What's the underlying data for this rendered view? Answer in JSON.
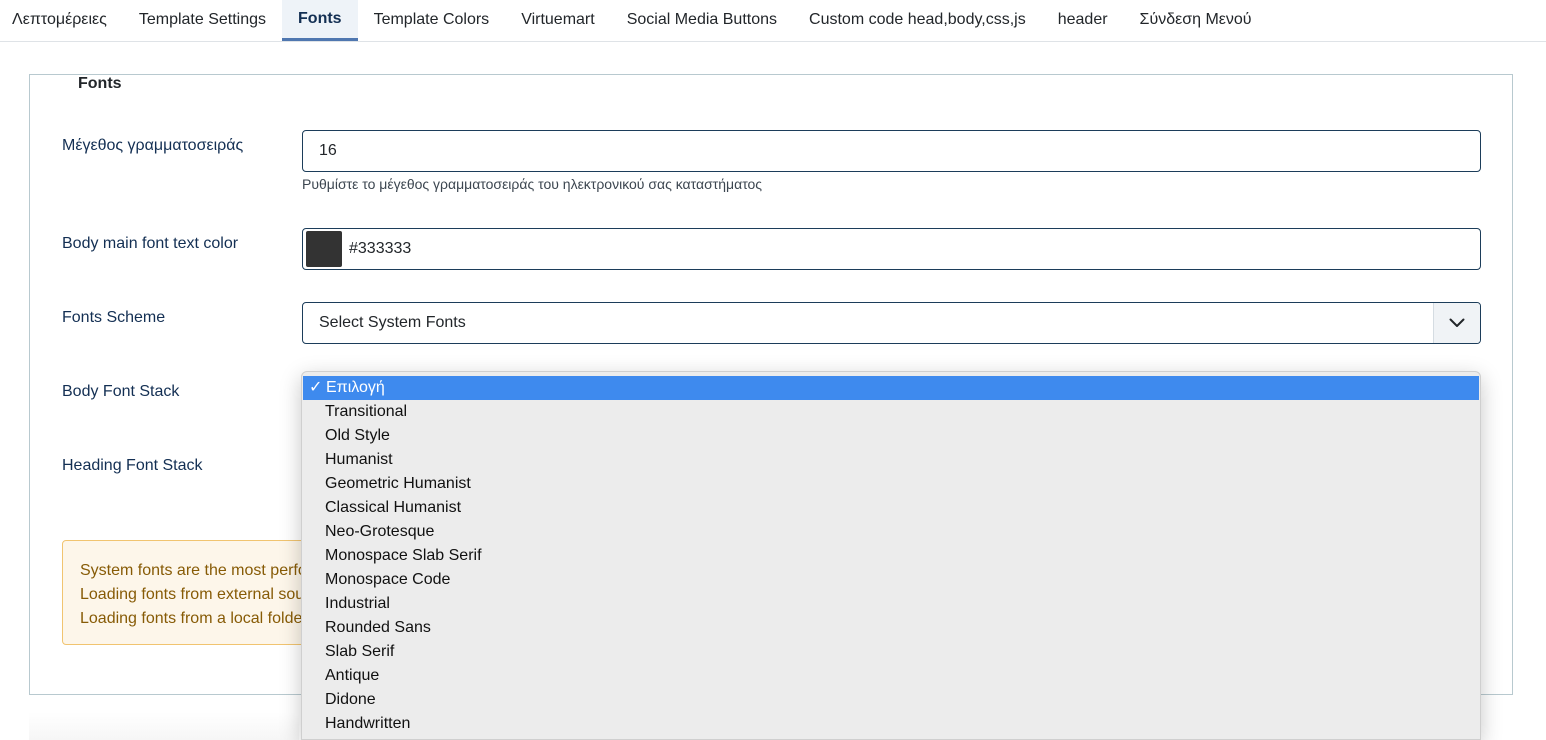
{
  "tabs": [
    {
      "label": "Λεπτομέρειες"
    },
    {
      "label": "Template Settings"
    },
    {
      "label": "Fonts"
    },
    {
      "label": "Template Colors"
    },
    {
      "label": "Virtuemart"
    },
    {
      "label": "Social Media Buttons"
    },
    {
      "label": "Custom code head,body,css,js"
    },
    {
      "label": "header"
    },
    {
      "label": "Σύνδεση Μενού"
    }
  ],
  "active_tab": "Fonts",
  "fieldset": {
    "legend": "Fonts"
  },
  "font_size": {
    "label": "Μέγεθος γραμματοσειράς",
    "value": "16",
    "help": "Ρυθμίστε το μέγεθος γραμματοσειράς του ηλεκτρονικού σας καταστήματος"
  },
  "body_color": {
    "label": "Body main font text color",
    "value": "#333333",
    "swatch": "#333333"
  },
  "fonts_scheme": {
    "label": "Fonts Scheme",
    "selected": "Select System Fonts",
    "icon": "chevron-down-icon"
  },
  "body_font_stack": {
    "label": "Body Font Stack"
  },
  "heading_font_stack": {
    "label": "Heading Font Stack"
  },
  "alert": {
    "lines": [
      "System fonts are the most perfo",
      "Loading fonts from external sou",
      "Loading fonts from a local folde"
    ]
  },
  "dropdown": {
    "check_mark": "✓",
    "options": [
      "Επιλογή",
      "Transitional",
      "Old Style",
      "Humanist",
      "Geometric Humanist",
      "Classical Humanist",
      "Neo-Grotesque",
      "Monospace Slab Serif",
      "Monospace Code",
      "Industrial",
      "Rounded Sans",
      "Slab Serif",
      "Antique",
      "Didone",
      "Handwritten"
    ],
    "selected_index": 0
  },
  "colors": {
    "accent": "#4f77b0",
    "highlight": "#3e8aee",
    "alert_text": "#875b06",
    "alert_bg": "#fdf6ea",
    "alert_border": "#f1c470"
  }
}
